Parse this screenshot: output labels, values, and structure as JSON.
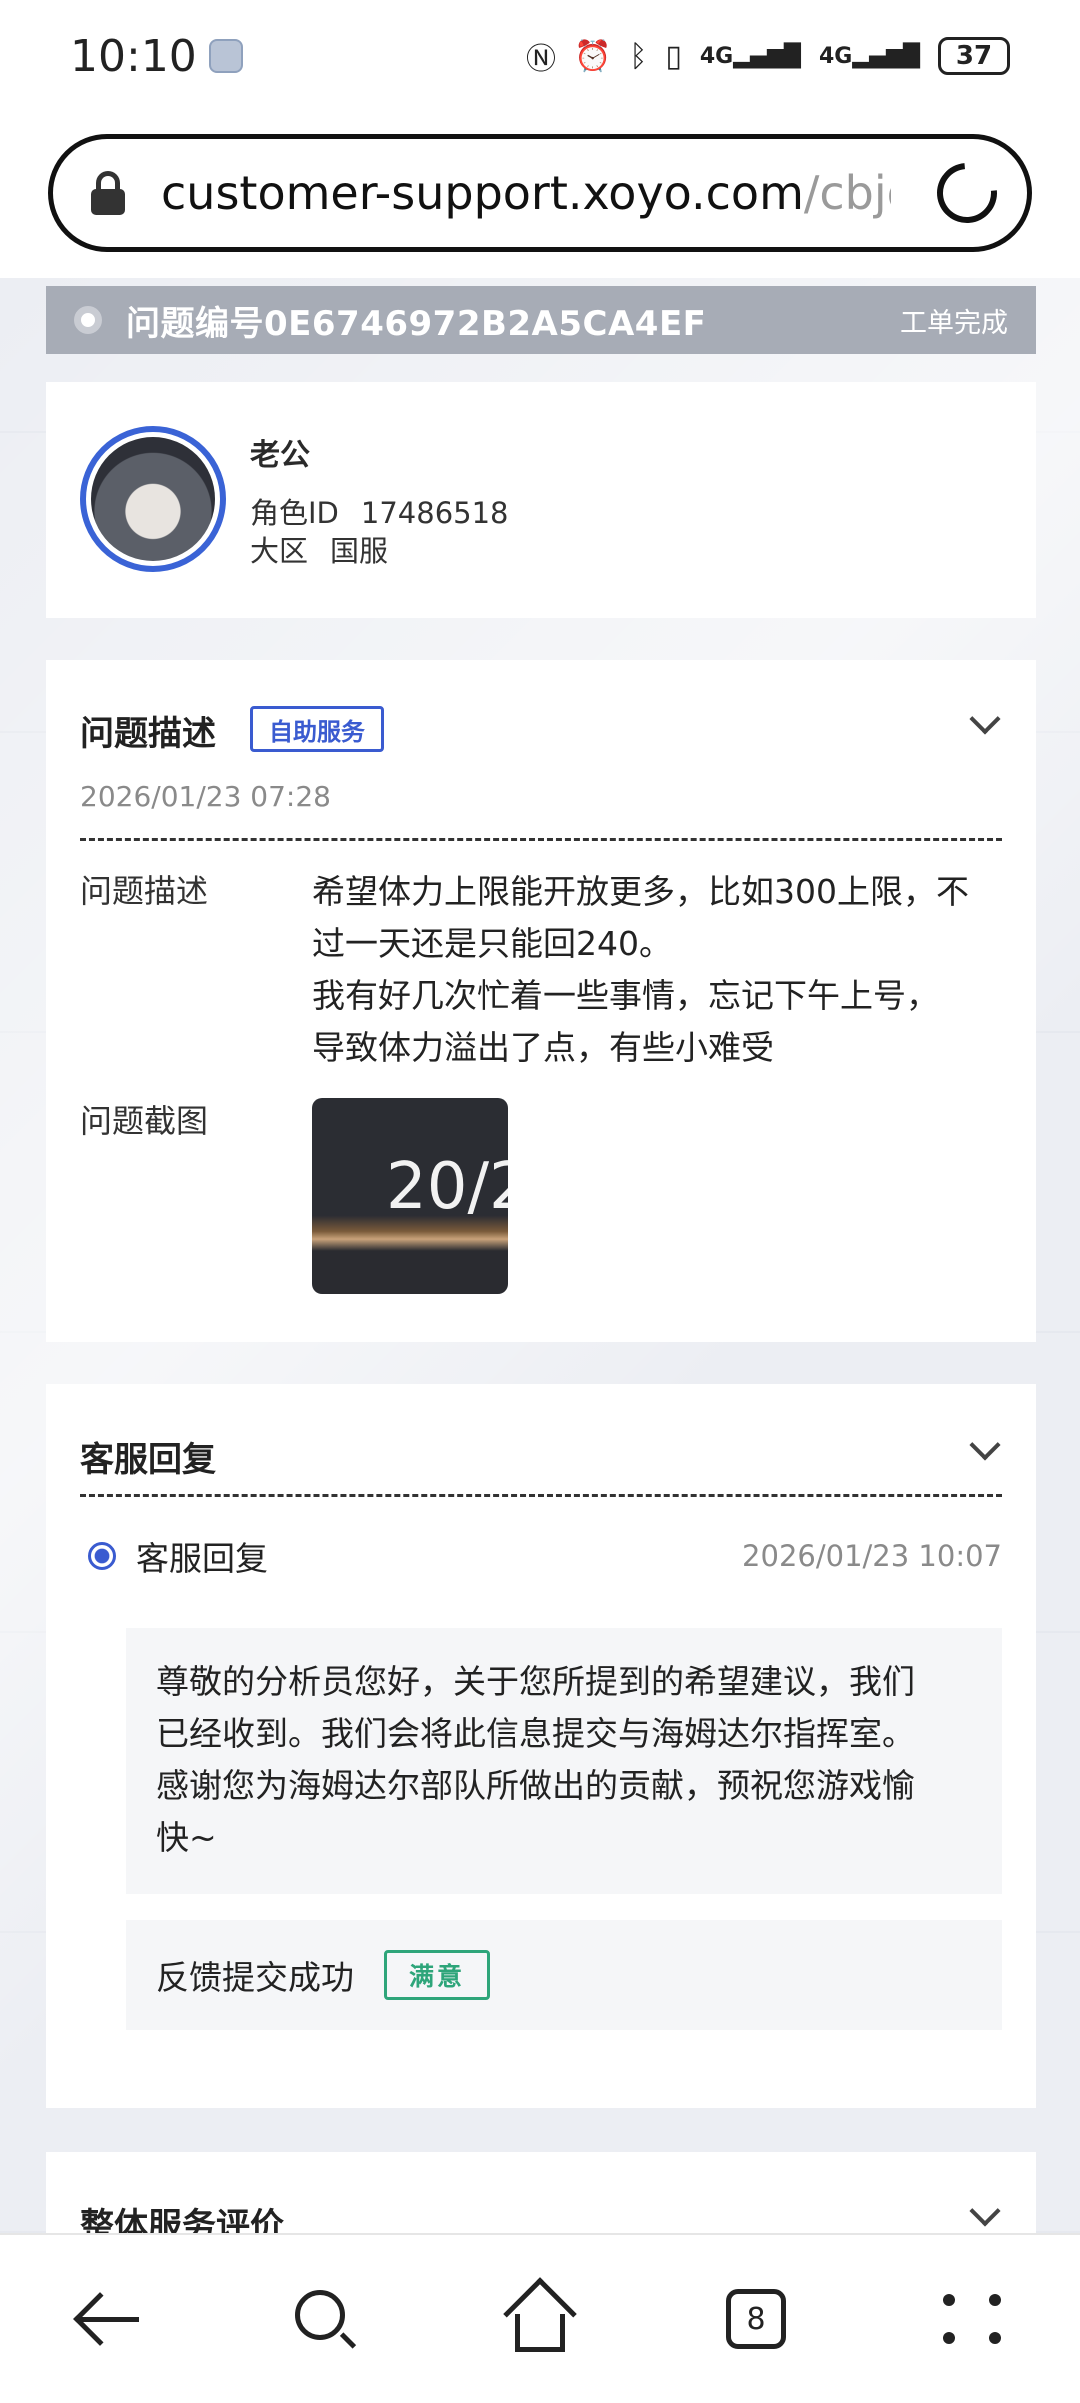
{
  "status_bar": {
    "time": "10:10",
    "icons": [
      "nfc-icon",
      "alarm-icon",
      "bluetooth-icon",
      "vibrate-icon",
      "signal-4g-icon",
      "signal-4g-icon"
    ],
    "network_1": "4G",
    "network_2": "4G",
    "battery": "37"
  },
  "browser": {
    "url_host": "customer-support.xoyo.com",
    "url_path": "/cbjq/"
  },
  "ticket": {
    "id_label": "问题编号0E6746972B2A5CA4EF",
    "status": "工单完成"
  },
  "profile": {
    "name": "老公",
    "role_id_label": "角色ID",
    "role_id": "17486518",
    "region_label": "大区",
    "region": "国服"
  },
  "issue": {
    "title": "问题描述",
    "badge": "自助服务",
    "time": "2026/01/23 07:28",
    "desc_label": "问题描述",
    "desc_lines": [
      "希望体力上限能开放更多，比如300上限，不",
      "过一天还是只能回240。",
      "我有好几次忙着一些事情，忘记下午上号，",
      "导致体力溢出了点，有些小难受"
    ],
    "screenshot_label": "问题截图",
    "screenshot_text": "20/2"
  },
  "reply": {
    "title": "客服回复",
    "row_label": "客服回复",
    "row_time": "2026/01/23 10:07",
    "message_lines": [
      "尊敬的分析员您好，关于您所提到的希望建议，我们",
      "已经收到。我们会将此信息提交与海姆达尔指挥室。",
      "感谢您为海姆达尔部队所做出的贡献，预祝您游戏愉",
      "快~"
    ],
    "feedback_text": "反馈提交成功",
    "feedback_badge": "满意"
  },
  "overall": {
    "title": "整体服务评价"
  },
  "bottom_nav": {
    "tab_count": "8"
  }
}
